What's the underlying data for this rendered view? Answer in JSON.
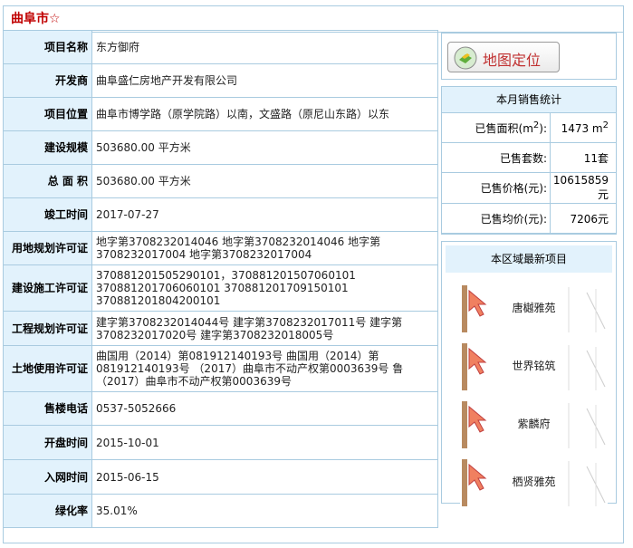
{
  "city": {
    "name": "曲阜市",
    "star": "☆"
  },
  "info_rows": [
    {
      "label": "项目名称",
      "value": "东方御府"
    },
    {
      "label": "开发商",
      "value": "曲阜盛仁房地产开发有限公司"
    },
    {
      "label": "项目位置",
      "value": "曲阜市博学路（原学院路）以南，文盛路（原尼山东路）以东"
    },
    {
      "label": "建设规模",
      "value": "503680.00 平方米"
    },
    {
      "label": "总 面 积",
      "value": "503680.00 平方米"
    },
    {
      "label": "竣工时间",
      "value": "2017-07-27"
    },
    {
      "label": "用地规划许可证",
      "value": "地字第3708232014046 地字第3708232014046 地字第3708232017004 地字第3708232017004"
    },
    {
      "label": "建设施工许可证",
      "value": "370881201505290101，370881201507060101 370881201706060101 370881201709150101 370881201804200101"
    },
    {
      "label": "工程规划许可证",
      "value": "建字第3708232014044号 建字第3708232017011号 建字第3708232017020号 建字第3708232018005号"
    },
    {
      "label": "土地使用许可证",
      "value": "曲国用（2014）第081912140193号 曲国用（2014）第081912140193号 （2017）曲阜市不动产权第0003639号 鲁（2017）曲阜市不动产权第0003639号"
    },
    {
      "label": "售楼电话",
      "value": "0537-5052666"
    },
    {
      "label": "开盘时间",
      "value": "2015-10-01"
    },
    {
      "label": "入网时间",
      "value": "2015-06-15"
    },
    {
      "label": "绿化率",
      "value": "35.01%"
    }
  ],
  "map": {
    "label": "地图定位",
    "icon": "map-location-icon"
  },
  "sales": {
    "title": "本月销售统计",
    "rows": [
      {
        "label": "已售面积(m",
        "sup": "2",
        "label_end": "):",
        "value": "1473 m",
        "value_sup": "2"
      },
      {
        "label": "已售套数:",
        "value": "11套"
      },
      {
        "label": "已售价格(元):",
        "value": "10615859元"
      },
      {
        "label": "已售均价(元):",
        "value": "7206元"
      }
    ]
  },
  "latest": {
    "title": "本区域最新项目",
    "projects": [
      {
        "name": "唐樾雅苑"
      },
      {
        "name": "世界铭筑"
      },
      {
        "name": "紫麟府"
      },
      {
        "name": "栖贤雅苑"
      }
    ]
  }
}
